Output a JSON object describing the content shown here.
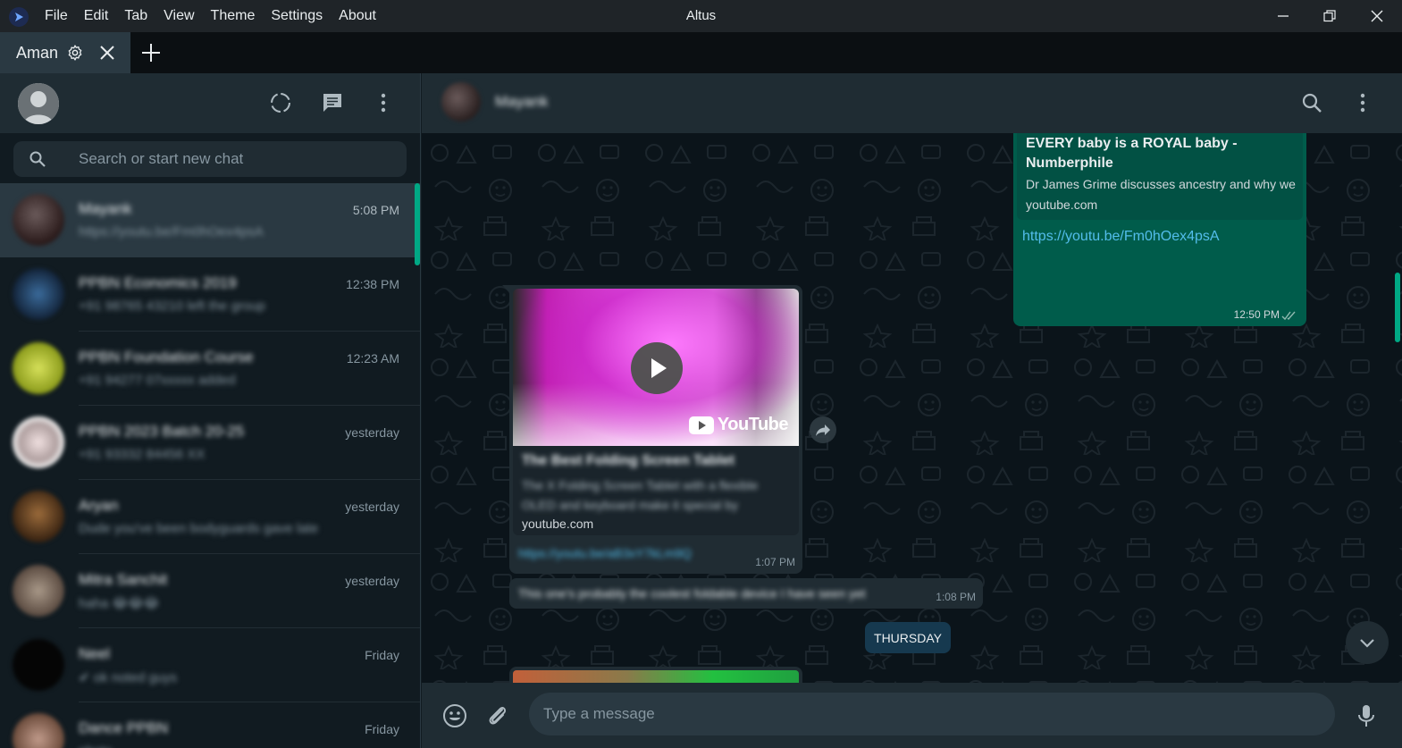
{
  "app": {
    "title": "Altus",
    "menu": [
      "File",
      "Edit",
      "Tab",
      "View",
      "Theme",
      "Settings",
      "About"
    ]
  },
  "tabs": {
    "active_label": "Aman"
  },
  "sidebar": {
    "search_placeholder": "Search or start new chat",
    "chats": [
      {
        "name": "Mayank",
        "preview": "https://youtu.be/Fm0hOex4psA",
        "time": "5:08 PM",
        "avatar_color": "#3a2a2a"
      },
      {
        "name": "PPBN Economics 2019",
        "preview": "+91 98765 43210 left the group",
        "time": "12:38 PM",
        "avatar_color": "#23436a"
      },
      {
        "name": "PPBN Foundation Course",
        "preview": "+91 94277 07xxxxx added",
        "time": "12:23 AM",
        "avatar_color": "#a8b82a"
      },
      {
        "name": "PPBN 2023 Batch 20-25",
        "preview": "+91 93332 84456 XX",
        "time": "yesterday",
        "avatar_color": "#d8d8d8"
      },
      {
        "name": "Aryan",
        "preview": "Dude you've been bodyguards gave late",
        "time": "yesterday",
        "avatar_color": "#5a3a1e"
      },
      {
        "name": "Mitra Sanchit",
        "preview": "haha 😂😂😂",
        "time": "yesterday",
        "avatar_color": "#7a6a5e"
      },
      {
        "name": "Neel",
        "preview": "✔ ok noted guys",
        "time": "Friday",
        "avatar_color": "#0a0a0a"
      },
      {
        "name": "Dance PPBN",
        "preview": "photo",
        "time": "Friday",
        "avatar_color": "#8a6a5a"
      }
    ]
  },
  "conversation": {
    "contact_name": "Mayank",
    "outgoing": {
      "link_title": "EVERY baby is a ROYAL baby - Numberphile",
      "link_desc": "Dr James Grime discusses ancestry and why we",
      "link_domain": "youtube.com",
      "url": "https://youtu.be/Fm0hOex4psA",
      "time": "12:50 PM"
    },
    "incoming_video": {
      "yt_label": "YouTube",
      "title": "The Best Folding Screen Tablet",
      "desc_line1": "The X Folding Screen Tablet with a flexible",
      "desc_line2": "OLED and keyboard make it special by",
      "domain": "youtube.com",
      "link": "https://youtu.be/aB3xY7kLm9Q",
      "time": "1:07 PM"
    },
    "incoming_text": {
      "text": "This one's probably the coolest foldable device I have seen yet",
      "time": "1:08 PM"
    },
    "date_chip": "THURSDAY",
    "message_placeholder": "Type a message"
  }
}
